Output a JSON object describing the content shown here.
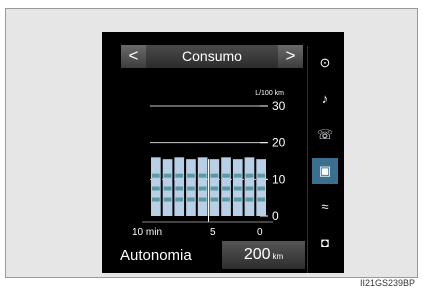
{
  "header": {
    "title": "Consumo",
    "prev_symbol": "<",
    "next_symbol": ">"
  },
  "chart_data": {
    "type": "bar",
    "unit_label": "L/100 km",
    "y_ticks": [
      "30",
      "20",
      "10",
      "0"
    ],
    "ylim": [
      0,
      30
    ],
    "x_tick_labels": [
      "10 min",
      "5",
      "0"
    ],
    "values": [
      16,
      15.5,
      16,
      15.5,
      16,
      15.5,
      16,
      15.5,
      16,
      15.5
    ],
    "bar_color": "#b8cfe6",
    "grid": true
  },
  "sidebar": {
    "items": [
      {
        "name": "navigation-icon",
        "glyph": "⊙",
        "active": false
      },
      {
        "name": "music-note-icon",
        "glyph": "♪",
        "active": false
      },
      {
        "name": "phone-icon",
        "glyph": "☏",
        "active": false
      },
      {
        "name": "info-screen-icon",
        "glyph": "▣",
        "active": true
      },
      {
        "name": "climate-icon",
        "glyph": "≈",
        "active": false
      },
      {
        "name": "setup-icon",
        "glyph": "◘",
        "active": false
      }
    ]
  },
  "footer": {
    "label": "Autonomia",
    "value": "200",
    "unit": "km"
  },
  "caption": "II21GS239BP"
}
